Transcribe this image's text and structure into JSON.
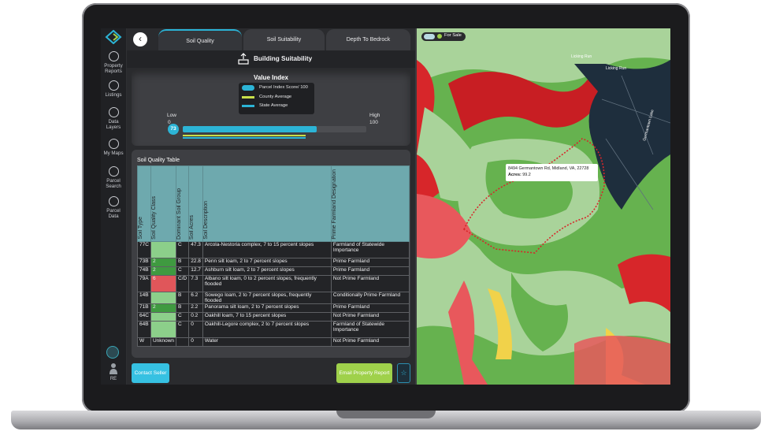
{
  "sidebar": {
    "items": [
      {
        "label_line1": "Property",
        "label_line2": "Reports",
        "icon": "report-icon"
      },
      {
        "label_line1": "Listings",
        "label_line2": "",
        "icon": "location-pin-icon"
      },
      {
        "label_line1": "Data",
        "label_line2": "Layers",
        "icon": "layers-icon"
      },
      {
        "label_line1": "My Maps",
        "label_line2": "",
        "icon": "map-icon"
      },
      {
        "label_line1": "Parcel",
        "label_line2": "Search",
        "icon": "search-icon"
      },
      {
        "label_line1": "Parcel",
        "label_line2": "Data",
        "icon": "document-icon"
      }
    ],
    "user_initials": "RE"
  },
  "tabs": [
    {
      "label": "Soil Quality",
      "active": true
    },
    {
      "label": "Soil Suitability",
      "active": false
    },
    {
      "label": "Depth To Bedrock",
      "active": false
    }
  ],
  "section_title": "Building Suitability",
  "value_index": {
    "title": "Value Index",
    "legend": [
      {
        "label": "Parcel Index Score/ 100",
        "color": "#2cb4d6"
      },
      {
        "label": "County Average",
        "color": "#c8e04a"
      },
      {
        "label": "State Average",
        "color": "#2cb4d6"
      }
    ],
    "low_label": "Low",
    "high_label": "High",
    "min": "0",
    "max": "100",
    "score": "73",
    "score_value": 73,
    "county_average": 67,
    "state_average": 67
  },
  "soil_table": {
    "title": "Soil Quality Table",
    "headers": [
      "Soil Type",
      "Soil Quality Class",
      "Dominant Soil Group",
      "Soil Acres",
      "Soil Description",
      "Prime Farmland Designation"
    ],
    "rows": [
      {
        "type": "77C",
        "quality": "",
        "quality_color": "lgreen",
        "group": "C",
        "acres": "47.3",
        "description": "Arcola-Nestoria complex, 7 to 15 percent slopes",
        "farmland": "Farmland of Statewide Importance",
        "tall": true
      },
      {
        "type": "73B",
        "quality": "2",
        "quality_color": "green",
        "group": "B",
        "acres": "22.8",
        "description": "Penn silt loam, 2 to 7 percent slopes",
        "farmland": "Prime Farmland",
        "tall": false
      },
      {
        "type": "74B",
        "quality": "2",
        "quality_color": "green",
        "group": "C",
        "acres": "12.7",
        "description": "Ashburn silt loam, 2 to 7 percent slopes",
        "farmland": "Prime Farmland",
        "tall": false
      },
      {
        "type": "79A",
        "quality": "6",
        "quality_color": "red",
        "group": "C/D",
        "acres": "7.3",
        "description": "Albano silt loam, 0 to 2 percent slopes, frequently flooded",
        "farmland": "Not Prime Farmland",
        "tall": true
      },
      {
        "type": "14B",
        "quality": "",
        "quality_color": "lgreen",
        "group": "B",
        "acres": "6.2",
        "description": "Sowego loam, 2 to 7 percent slopes, frequently flooded",
        "farmland": "Conditionally Prime Farmland",
        "tall": false
      },
      {
        "type": "71B",
        "quality": "2",
        "quality_color": "green",
        "group": "B",
        "acres": "2.2",
        "description": "Panorama silt loam, 2 to 7 percent slopes",
        "farmland": "Prime Farmland",
        "tall": false
      },
      {
        "type": "64C",
        "quality": "",
        "quality_color": "lgreen",
        "group": "C",
        "acres": "0.2",
        "description": "Oakhill loam, 7 to 15 percent slopes",
        "farmland": "Not Prime Farmland",
        "tall": false
      },
      {
        "type": "64B",
        "quality": "",
        "quality_color": "lgreen",
        "group": "C",
        "acres": "0",
        "description": "Oakhill-Legore complex, 2 to 7 percent slopes",
        "farmland": "Farmland of Statewide Importance",
        "tall": true
      },
      {
        "type": "W",
        "quality": "Unknown",
        "quality_color": "none",
        "group": "",
        "acres": "0",
        "description": "Water",
        "farmland": "Not Prime Farmland",
        "tall": false
      }
    ]
  },
  "buttons": {
    "contact": "Contact Seller",
    "email": "Email Property Report",
    "back_glyph": "‹",
    "star_glyph": "☆"
  },
  "map": {
    "toggle_label": "For Sale",
    "popup_address": "8494 Germantown Rd, Midland, VA, 22728",
    "popup_acres_label": "Acres:",
    "popup_acres_value": "99.2",
    "road_labels": [
      "Licking Run",
      "Licking Run",
      "Germantown Lake"
    ]
  }
}
